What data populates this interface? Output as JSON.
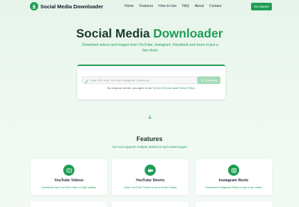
{
  "header": {
    "brand": "Social Media Downloader",
    "nav": [
      "Home",
      "Features",
      "How to Use",
      "FAQ",
      "About",
      "Contact"
    ],
    "cta": "Get Started"
  },
  "hero": {
    "title_part1": "Social Media ",
    "title_part2": "Downloader",
    "subtitle": "Download videos and images from YouTube, Instagram, Facebook and more in just a few clicks"
  },
  "search": {
    "placeholder": "Paste URL from YouTube, Instagram, Facebook...",
    "button": "Download",
    "terms_prefix": "By using our service, you agree to our ",
    "terms_link": "Terms of Service",
    "terms_and": " and ",
    "privacy_link": "Privacy Policy",
    "terms_suffix": "."
  },
  "features": {
    "title": "Features",
    "subtitle": "Our tool supports multiple platforms and content types",
    "items": [
      {
        "title": "YouTube Videos",
        "desc": "Download any YouTube video in high quality",
        "icon": "youtube-icon"
      },
      {
        "title": "YouTube Shorts",
        "desc": "Save YouTube Shorts to your device easily",
        "icon": "video-camera-icon"
      },
      {
        "title": "Instagram Reels",
        "desc": "Download Instagram Reels in just a few clicks",
        "icon": "instagram-icon"
      }
    ]
  },
  "colors": {
    "accent": "#1f9d55",
    "heading": "#1a3a2a",
    "button_disabled": "#a7dcb8"
  }
}
